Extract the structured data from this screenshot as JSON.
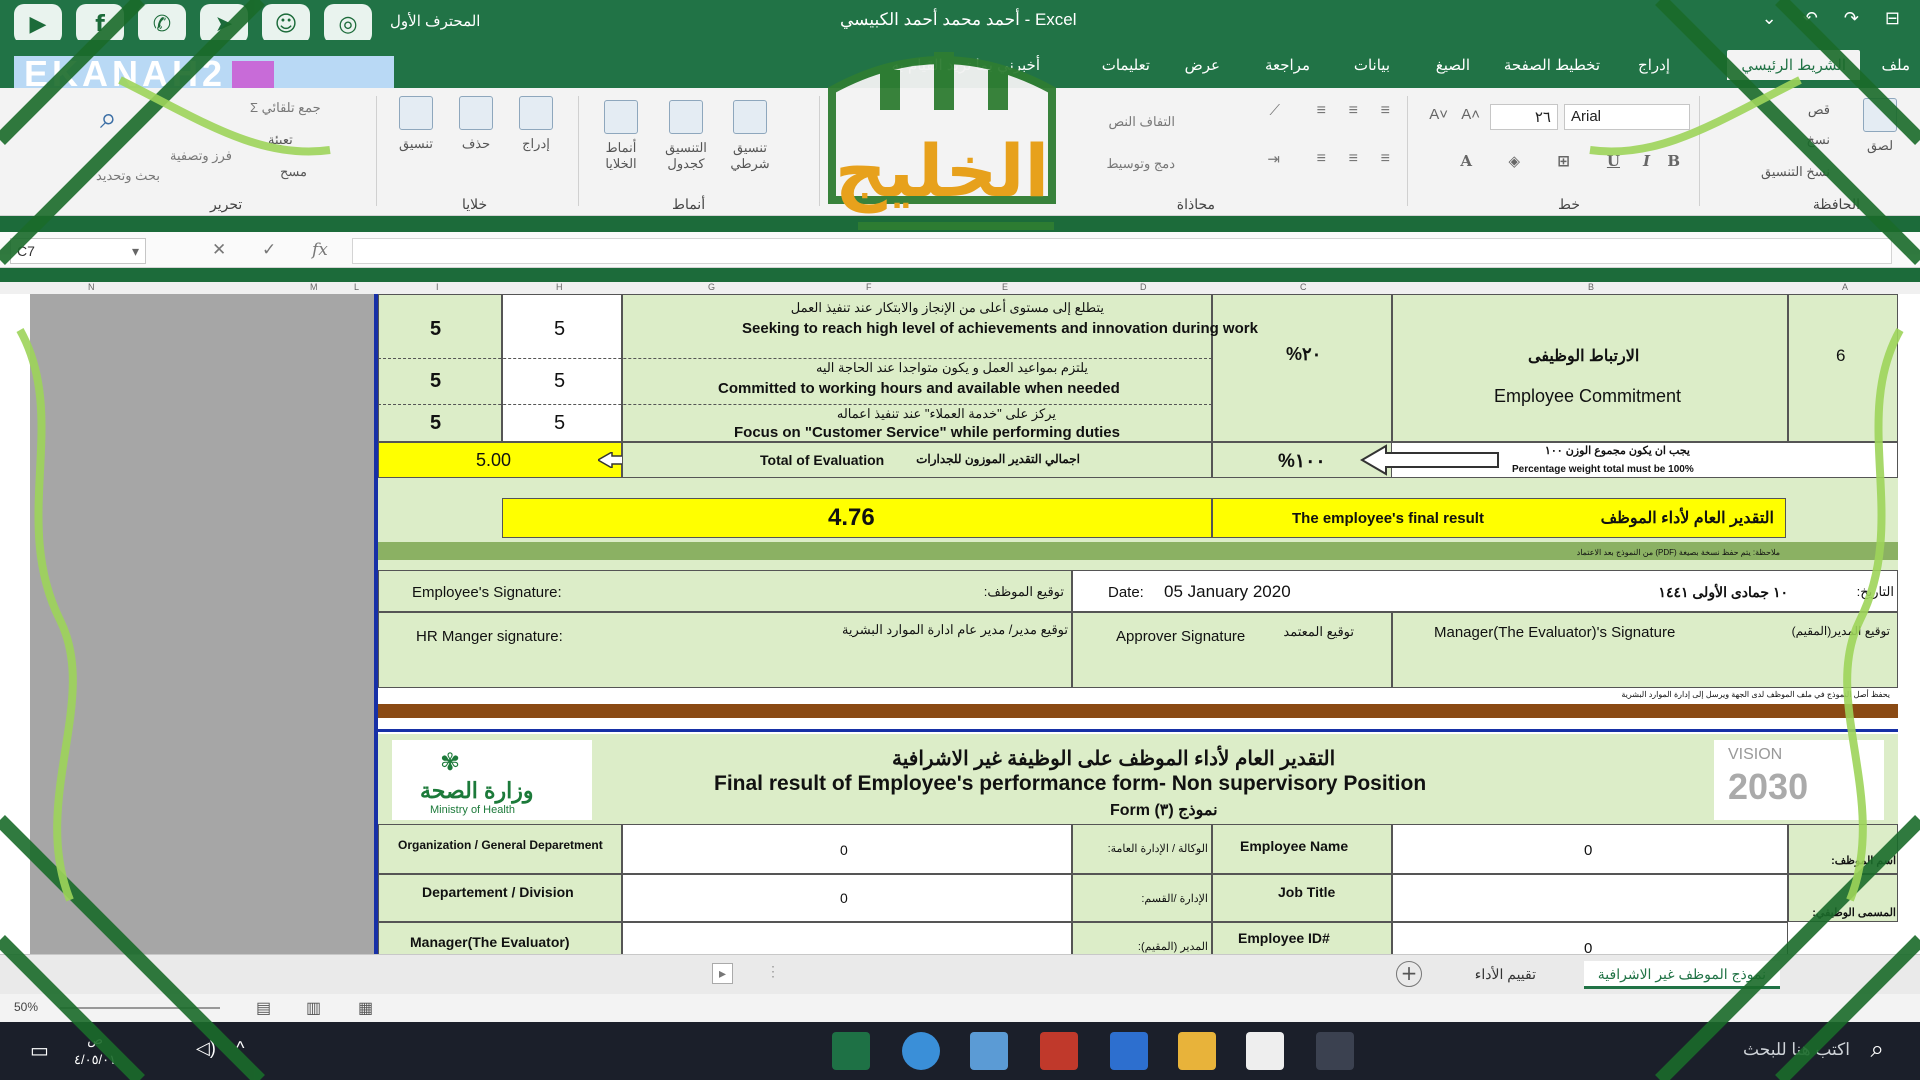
{
  "titlebar": {
    "app_name": "Excel",
    "doc_title": "أحمد محمد أحمد الكبيسي",
    "autosave": "المحترف الأول",
    "social_icons": [
      "youtube-icon",
      "facebook-icon",
      "whatsapp-icon",
      "telegram-icon",
      "snapchat-icon",
      "instagram-icon"
    ]
  },
  "brand": {
    "text": "EKANAH2"
  },
  "tabs": {
    "home": "الشريط الرئيسي",
    "insert": "إدراج",
    "page_layout": "تخطيط الصفحة",
    "formulas": "الصيغ",
    "data": "بيانات",
    "review": "مراجعة",
    "view": "عرض",
    "help": "تعليمات",
    "tell_me": "أخبرني بما تريد القيام به",
    "file": "ملف"
  },
  "ribbon": {
    "clipboard_label": "الحافظة",
    "paste": "لصق",
    "cut": "قص",
    "copy": "نسخ",
    "format_painter": "نسخ التنسيق",
    "font_label": "خط",
    "font_name": "Arial",
    "font_size": "٢٦",
    "alignment_label": "محاذاة",
    "wrap_text": "التفاف النص",
    "merge_center": "دمج وتوسيط",
    "styles_label": "أنماط",
    "cond_format": "تنسيق شرطي",
    "format_table": "التنسيق كجدول",
    "cell_styles": "أنماط الخلايا",
    "cells_label": "خلايا",
    "insert": "إدراج",
    "delete": "حذف",
    "format": "تنسيق",
    "editing_label": "تحرير",
    "autosum": "جمع تلقائي",
    "fill": "تعبئة",
    "clear": "مسح",
    "sort_filter": "فرز وتصفية",
    "find_select": "بحث وتحديد"
  },
  "formula_bar": {
    "name_box": "C7",
    "fx": "fx",
    "value": ""
  },
  "columns": [
    "N",
    "M",
    "L",
    "I",
    "H",
    "G",
    "F",
    "E",
    "D",
    "C",
    "B",
    "A"
  ],
  "sheet": {
    "row6_num": "6",
    "criteria": [
      {
        "ar": "يتطلع إلى مستوى أعلى من الإنجاز والابتكار عند تنفيذ العمل",
        "en": "Seeking to reach high level of achievements and innovation during work",
        "i": "5",
        "h": "5"
      },
      {
        "ar": "يلتزم بمواعيد العمل و يكون متواجدا عند الحاجة اليه",
        "en": "Committed to working hours and available when needed",
        "i": "5",
        "h": "5"
      },
      {
        "ar": "يركز على \"خدمة العملاء\" عند تنفيذ اعماله",
        "en": "Focus on \"Customer Service\" while performing duties",
        "i": "5",
        "h": "5"
      }
    ],
    "weight": "%٢٠",
    "category_ar": "الارتباط الوظيفى",
    "category_en": "Employee Commitment",
    "total_value": "5.00",
    "total_label_en": "Total of Evaluation",
    "total_label_ar": "اجمالي التقدير الموزون للجدارات",
    "total_weight": "%١٠٠",
    "weight_note_ar": "يجب ان يكون مجموع الوزن ١٠٠",
    "weight_note_en": "Percentage weight total must be 100%",
    "final_value": "4.76",
    "final_label_en": "The employee's final result",
    "final_label_ar": "التقدير العام لأداء الموظف",
    "pdf_note": "ملاحظة: يتم حفظ نسخة بصيغة (PDF) من النموذج بعد الاعتماد",
    "emp_sig_en": "Employee's Signature:",
    "emp_sig_ar": "توقيع الموظف:",
    "date_en": "Date:",
    "date_value": "05 January 2020",
    "date_hijri": "١٠ جمادى الأولى ١٤٤١",
    "date_ar": "التاريخ:",
    "hr_sig_en": "HR Manger signature:",
    "hr_sig_ar": "توقيع مدير/ مدير عام ادارة الموارد البشرية",
    "approver_en": "Approver Signature",
    "approver_ar": "توقيع المعتمد",
    "manager_sig_en": "Manager(The Evaluator)'s Signature",
    "manager_sig_ar": "توقيع المدير(المقيم)",
    "footnote": "يحفظ أصل النموذج في ملف الموظف لدى الجهة ويرسل إلى إدارة الموارد البشرية",
    "form_title_ar": "التقدير العام لأداء الموظف على الوظيفة غير الاشرافية",
    "form_title_en": "Final result of  Employee's performance form- Non supervisory Position",
    "form_no": "Form (٣) نموذج",
    "moh_ar": "وزارة الصحة",
    "moh_en": "Ministry of Health",
    "vision_en": "VISION",
    "vision_year": "2030",
    "org_en": "Organization / General Deparetment",
    "org_ar": "الوكالة / الإدارة العامة:",
    "org_value": "0",
    "emp_name_en": "Employee Name",
    "emp_name_ar": "اسم الموظف:",
    "emp_name_value": "0",
    "dept_en": "Departement / Division",
    "dept_ar": "الإدارة /القسم:",
    "dept_value": "0",
    "job_title_en": "Job Title",
    "job_title_ar": "المسمى الوظيفي:",
    "job_title_value": "",
    "mgr_en": "Manager(The Evaluator)",
    "mgr_ar": "المدير (المقيم):",
    "emp_id_en": "Employee ID#",
    "emp_id_value": "0"
  },
  "sheet_tabs": {
    "active": "نموذج الموظف غير الاشرافية",
    "other": "تقييم الأداء"
  },
  "statusbar": {
    "zoom": "50%"
  },
  "taskbar": {
    "search": "اكتب هنا للبحث",
    "time": "ص",
    "date": "٤/٠٥/٠١"
  },
  "watermark": {
    "text": "الخليج"
  },
  "colors": {
    "excel_green": "#217346",
    "cell_green": "#dcedc8",
    "highlight_yellow": "#ffff00",
    "band_green": "#8bb163"
  }
}
